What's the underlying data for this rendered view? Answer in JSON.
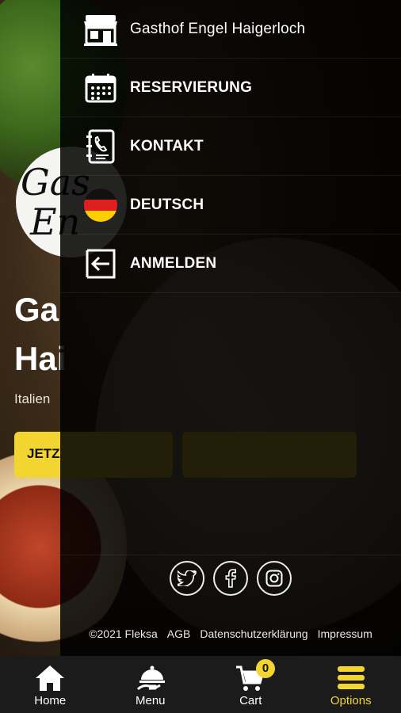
{
  "background": {
    "logo_lines": [
      "Gas",
      "En"
    ],
    "hero_title_lines": [
      "Ga",
      "Hai"
    ],
    "hero_subtitle": "Italien",
    "hero_button": "JETZ"
  },
  "drawer": {
    "items": [
      {
        "label": "Gasthof Engel Haigerloch",
        "icon": "restaurant-storefront-icon"
      },
      {
        "label": "RESERVIERUNG",
        "icon": "calendar-icon"
      },
      {
        "label": "KONTAKT",
        "icon": "phone-contact-icon"
      },
      {
        "label": "DEUTSCH",
        "icon": "german-flag-icon"
      },
      {
        "label": "ANMELDEN",
        "icon": "login-icon"
      }
    ],
    "social": [
      "twitter-icon",
      "facebook-icon",
      "instagram-icon"
    ],
    "footer_links": [
      "©2021 Fleksa",
      "AGB",
      "Datenschutzerklärung",
      "Impressum"
    ]
  },
  "bottom_nav": {
    "items": [
      {
        "label": "Home",
        "icon": "home-icon"
      },
      {
        "label": "Menu",
        "icon": "serving-cloche-icon"
      },
      {
        "label": "Cart",
        "icon": "cart-icon"
      },
      {
        "label": "Options",
        "icon": "hamburger-menu-icon"
      }
    ],
    "cart_count": "0",
    "active": "Options"
  },
  "colors": {
    "accent": "#f3d531",
    "drawer_bg": "#000000",
    "nav_bg": "#1b1b1b"
  }
}
